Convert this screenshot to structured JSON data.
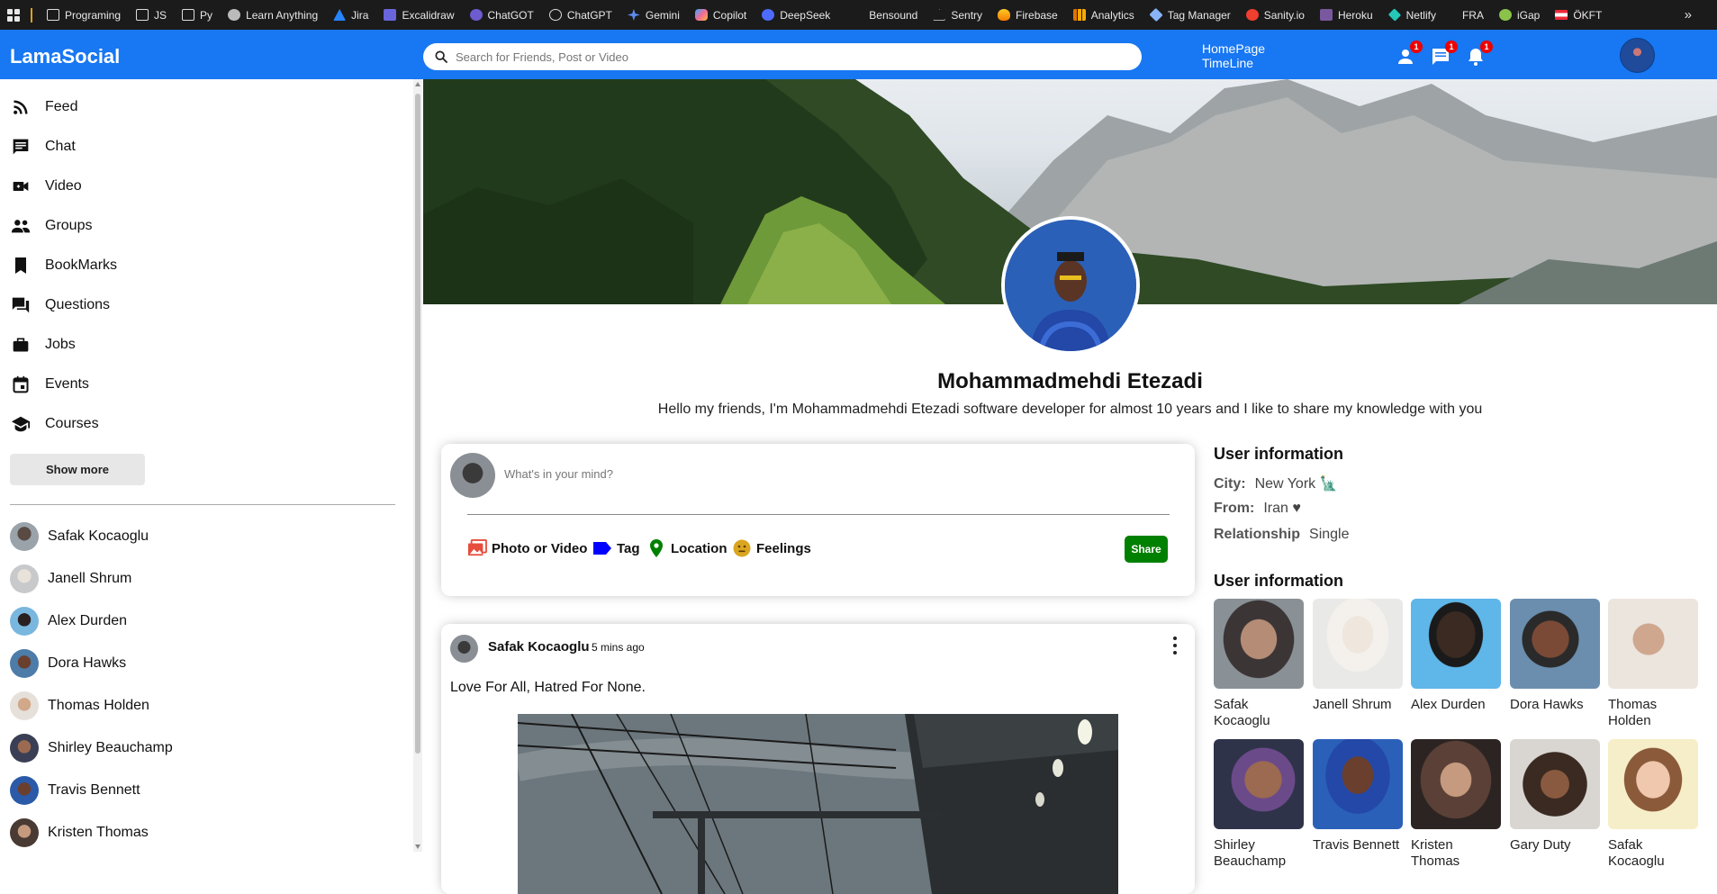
{
  "bookmarks": [
    {
      "label": "Programing",
      "icon": "folder-icon"
    },
    {
      "label": "JS",
      "icon": "folder-icon"
    },
    {
      "label": "Py",
      "icon": "folder-icon"
    },
    {
      "label": "Learn Anything",
      "icon": "learn-anything-icon"
    },
    {
      "label": "Jira",
      "icon": "jira-icon"
    },
    {
      "label": "Excalidraw",
      "icon": "excalidraw-icon"
    },
    {
      "label": "ChatGOT",
      "icon": "chatgot-icon"
    },
    {
      "label": "ChatGPT",
      "icon": "chatgpt-icon"
    },
    {
      "label": "Gemini",
      "icon": "gemini-icon"
    },
    {
      "label": "Copilot",
      "icon": "copilot-icon"
    },
    {
      "label": "DeepSeek",
      "icon": "deepseek-icon"
    },
    {
      "label": "Bensound",
      "icon": "bensound-icon"
    },
    {
      "label": "Sentry",
      "icon": "sentry-icon"
    },
    {
      "label": "Firebase",
      "icon": "firebase-icon"
    },
    {
      "label": "Analytics",
      "icon": "analytics-icon"
    },
    {
      "label": "Tag Manager",
      "icon": "tag-manager-icon"
    },
    {
      "label": "Sanity.io",
      "icon": "sanity-icon"
    },
    {
      "label": "Heroku",
      "icon": "heroku-icon"
    },
    {
      "label": "Netlify",
      "icon": "netlify-icon"
    },
    {
      "label": "FRA",
      "icon": "fra-icon"
    },
    {
      "label": "iGap",
      "icon": "igap-icon"
    },
    {
      "label": "ÖKFT",
      "icon": "flag-icon"
    }
  ],
  "bookmarks_more": "»",
  "header": {
    "logo": "LamaSocial",
    "search_placeholder": "Search for Friends, Post or Video",
    "links": [
      "HomePage",
      "TimeLine"
    ],
    "badges": {
      "friends": "1",
      "messages": "1",
      "notifications": "1"
    }
  },
  "sidebar": {
    "menu": [
      {
        "label": "Feed",
        "icon": "rss-feed-icon"
      },
      {
        "label": "Chat",
        "icon": "chat-icon"
      },
      {
        "label": "Video",
        "icon": "video-camera-icon"
      },
      {
        "label": "Groups",
        "icon": "groups-icon"
      },
      {
        "label": "BookMarks",
        "icon": "bookmark-icon"
      },
      {
        "label": "Questions",
        "icon": "questions-icon"
      },
      {
        "label": "Jobs",
        "icon": "briefcase-icon"
      },
      {
        "label": "Events",
        "icon": "calendar-icon"
      },
      {
        "label": "Courses",
        "icon": "school-icon"
      }
    ],
    "show_more": "Show more",
    "friends": [
      "Safak Kocaoglu",
      "Janell Shrum",
      "Alex Durden",
      "Dora Hawks",
      "Thomas Holden",
      "Shirley Beauchamp",
      "Travis Bennett",
      "Kristen Thomas"
    ]
  },
  "profile": {
    "name": "Mohammadmehdi Etezadi",
    "bio": "Hello my friends, I'm Mohammadmehdi Etezadi software developer for almost 10 years and I like to share my knowledge with you"
  },
  "share": {
    "placeholder": "What's in your mind?",
    "options": [
      {
        "label": "Photo or Video",
        "icon": "photo-icon",
        "color": "#e74c3c"
      },
      {
        "label": "Tag",
        "icon": "tag-icon",
        "color": "#0000ff"
      },
      {
        "label": "Location",
        "icon": "location-pin-icon",
        "color": "#008000"
      },
      {
        "label": "Feelings",
        "icon": "emoji-icon",
        "color": "#daa520"
      }
    ],
    "button": "Share"
  },
  "post": {
    "user": "Safak Kocaoglu",
    "time": "5 mins ago",
    "text": "Love For All, Hatred For None."
  },
  "user_info": {
    "title": "User information",
    "city_label": "City:",
    "city": "New York 🗽",
    "from_label": "From:",
    "from": "Iran ♥",
    "relationship_label": "Relationship",
    "relationship": "Single"
  },
  "friends_panel": {
    "title": "User information",
    "friends": [
      "Safak Kocaoglu",
      "Janell Shrum",
      "Alex Durden",
      "Dora Hawks",
      "Thomas Holden",
      "Shirley Beauchamp",
      "Travis Bennett",
      "Kristen Thomas",
      "Gary Duty",
      "Safak Kocaoglu"
    ]
  },
  "colors": {
    "brand": "#1877f2",
    "share_button": "#008000",
    "badge": "#e00000"
  }
}
